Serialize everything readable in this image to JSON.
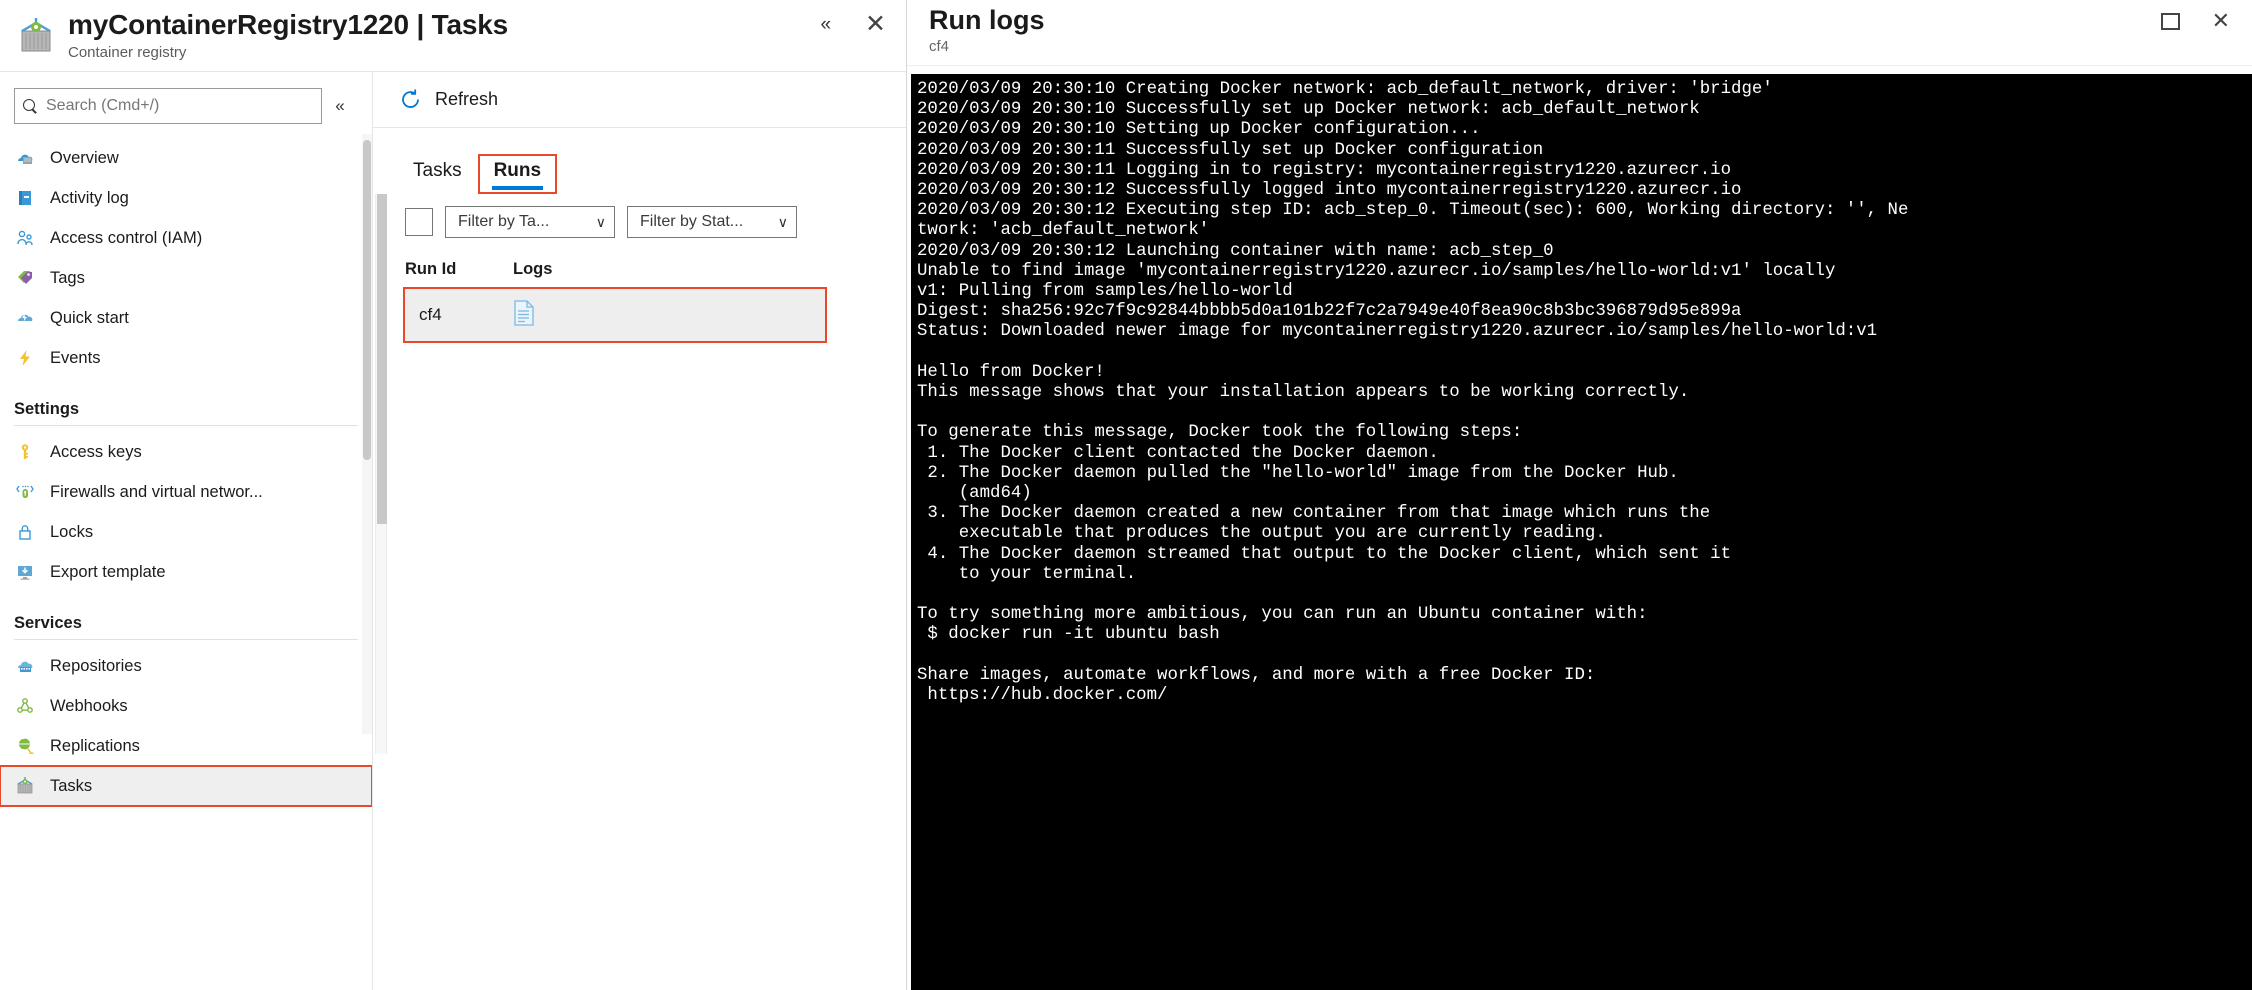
{
  "blade": {
    "title": "myContainerRegistry1220 | Tasks",
    "subtitle": "Container registry",
    "collapse_icon": "«",
    "close_icon": "✕"
  },
  "search": {
    "placeholder": "Search (Cmd+/)",
    "value": "",
    "icon": "search-icon",
    "collapse_icon": "«"
  },
  "sidebar": {
    "items": [
      {
        "label": "Overview",
        "icon": "cloud-server-icon",
        "type": "item"
      },
      {
        "label": "Activity log",
        "icon": "activity-log-icon",
        "type": "item"
      },
      {
        "label": "Access control (IAM)",
        "icon": "people-icon",
        "type": "item"
      },
      {
        "label": "Tags",
        "icon": "tags-icon",
        "type": "item"
      },
      {
        "label": "Quick start",
        "icon": "quick-start-icon",
        "type": "item"
      },
      {
        "label": "Events",
        "icon": "lightning-icon",
        "type": "item"
      },
      {
        "label": "Settings",
        "type": "section"
      },
      {
        "label": "Access keys",
        "icon": "key-icon",
        "type": "item"
      },
      {
        "label": "Firewalls and virtual networ...",
        "icon": "firewall-icon",
        "type": "item"
      },
      {
        "label": "Locks",
        "icon": "lock-icon",
        "type": "item"
      },
      {
        "label": "Export template",
        "icon": "export-template-icon",
        "type": "item"
      },
      {
        "label": "Services",
        "type": "section"
      },
      {
        "label": "Repositories",
        "icon": "repositories-icon",
        "type": "item"
      },
      {
        "label": "Webhooks",
        "icon": "webhooks-icon",
        "type": "item"
      },
      {
        "label": "Replications",
        "icon": "globe-icon",
        "type": "item"
      },
      {
        "label": "Tasks",
        "icon": "tasks-container-icon",
        "type": "item",
        "selected": true,
        "highlighted": true
      }
    ]
  },
  "toolbar": {
    "refresh_label": "Refresh",
    "refresh_icon": "refresh-icon"
  },
  "tabs": [
    {
      "label": "Tasks",
      "active": false,
      "highlighted": false
    },
    {
      "label": "Runs",
      "active": true,
      "highlighted": true
    }
  ],
  "filters": {
    "task_filter": "Filter by Ta...",
    "status_filter": "Filter by Stat...",
    "chevron": "∨"
  },
  "table": {
    "columns": [
      "Run Id",
      "Logs"
    ],
    "rows": [
      {
        "run_id": "cf4",
        "logs_icon": "log-document-icon",
        "highlighted": true
      }
    ]
  },
  "runlogs": {
    "title": "Run logs",
    "subtitle": "cf4",
    "maximize_icon": "maximize-icon",
    "close_icon": "✕",
    "text": "2020/03/09 20:30:10 Creating Docker network: acb_default_network, driver: 'bridge'\n2020/03/09 20:30:10 Successfully set up Docker network: acb_default_network\n2020/03/09 20:30:10 Setting up Docker configuration...\n2020/03/09 20:30:11 Successfully set up Docker configuration\n2020/03/09 20:30:11 Logging in to registry: mycontainerregistry1220.azurecr.io\n2020/03/09 20:30:12 Successfully logged into mycontainerregistry1220.azurecr.io\n2020/03/09 20:30:12 Executing step ID: acb_step_0. Timeout(sec): 600, Working directory: '', Ne\ntwork: 'acb_default_network'\n2020/03/09 20:30:12 Launching container with name: acb_step_0\nUnable to find image 'mycontainerregistry1220.azurecr.io/samples/hello-world:v1' locally\nv1: Pulling from samples/hello-world\nDigest: sha256:92c7f9c92844bbbb5d0a101b22f7c2a7949e40f8ea90c8b3bc396879d95e899a\nStatus: Downloaded newer image for mycontainerregistry1220.azurecr.io/samples/hello-world:v1\n\nHello from Docker!\nThis message shows that your installation appears to be working correctly.\n\nTo generate this message, Docker took the following steps:\n 1. The Docker client contacted the Docker daemon.\n 2. The Docker daemon pulled the \"hello-world\" image from the Docker Hub.\n    (amd64)\n 3. The Docker daemon created a new container from that image which runs the\n    executable that produces the output you are currently reading.\n 4. The Docker daemon streamed that output to the Docker client, which sent it\n    to your terminal.\n\nTo try something more ambitious, you can run an Ubuntu container with:\n $ docker run -it ubuntu bash\n\nShare images, automate workflows, and more with a free Docker ID:\n https://hub.docker.com/\n"
  },
  "colors": {
    "accent": "#0078d4",
    "highlight_box": "#e8492a",
    "terminal_bg": "#000000",
    "terminal_fg": "#ffffff"
  }
}
